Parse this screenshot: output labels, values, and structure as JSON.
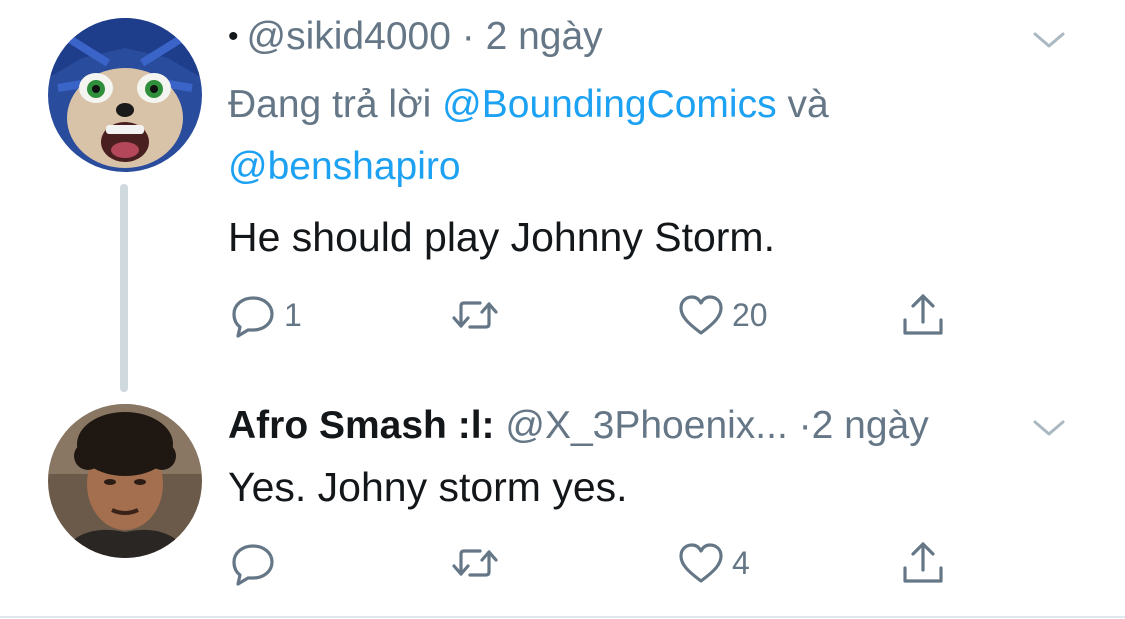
{
  "tweets": [
    {
      "handle": "@sikid4000",
      "separator": "·",
      "time": "2 ngày",
      "reply_prefix": "Đang trả lời",
      "reply_mention_1": "@BoundingComics",
      "reply_conjunction": "và",
      "reply_mention_2": "@benshapiro",
      "text": "He should play Johnny Storm.",
      "reply_count": "1",
      "retweet_count": "",
      "like_count": "20",
      "avatar_icon": "sonic-avatar-icon"
    },
    {
      "name": "Afro Smash :l:",
      "handle": "@X_3Phoenix...",
      "separator": "·",
      "time": "2 ngày",
      "text": "Yes. Johny storm yes.",
      "reply_count": "",
      "retweet_count": "",
      "like_count": "4",
      "avatar_icon": "person-avatar-icon"
    }
  ],
  "colors": {
    "link": "#1da1f2",
    "muted": "#657786",
    "text": "#14171a",
    "thread_line": "#cfd9de"
  }
}
